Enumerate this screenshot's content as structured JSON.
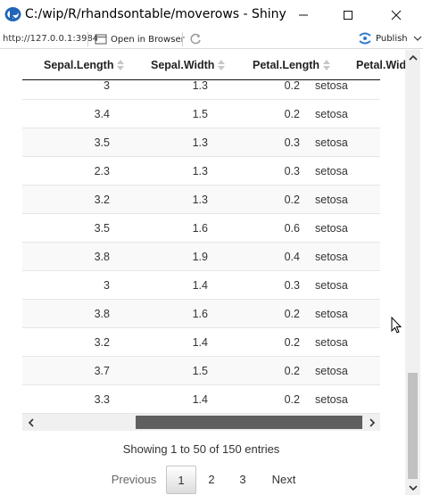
{
  "window": {
    "title": "C:/wip/R/rhandsontable/moverows - Shiny",
    "icon": "r-logo-icon",
    "controls": [
      "minimize",
      "maximize",
      "close"
    ]
  },
  "toolbar": {
    "url": "http://127.0.0.1:3984",
    "open_in_browser": "Open in Browser",
    "publish": "Publish"
  },
  "table": {
    "columns": [
      "Sepal.Length",
      "Sepal.Width",
      "Petal.Length",
      "Petal.Wid"
    ],
    "rows": [
      [
        "3",
        "1.3",
        "0.2",
        "setosa"
      ],
      [
        "3.4",
        "1.5",
        "0.2",
        "setosa"
      ],
      [
        "3.5",
        "1.3",
        "0.3",
        "setosa"
      ],
      [
        "2.3",
        "1.3",
        "0.3",
        "setosa"
      ],
      [
        "3.2",
        "1.3",
        "0.2",
        "setosa"
      ],
      [
        "3.5",
        "1.6",
        "0.6",
        "setosa"
      ],
      [
        "3.8",
        "1.9",
        "0.4",
        "setosa"
      ],
      [
        "3",
        "1.4",
        "0.3",
        "setosa"
      ],
      [
        "3.8",
        "1.6",
        "0.2",
        "setosa"
      ],
      [
        "3.2",
        "1.4",
        "0.2",
        "setosa"
      ],
      [
        "3.7",
        "1.5",
        "0.2",
        "setosa"
      ],
      [
        "3.3",
        "1.4",
        "0.2",
        "setosa"
      ]
    ]
  },
  "info": "Showing 1 to 50 of 150 entries",
  "pagination": {
    "previous": "Previous",
    "pages": [
      "1",
      "2",
      "3"
    ],
    "current": "1",
    "next": "Next"
  },
  "colors": {
    "accent": "#2e7bcf",
    "stripe": "#f9f9f9"
  }
}
